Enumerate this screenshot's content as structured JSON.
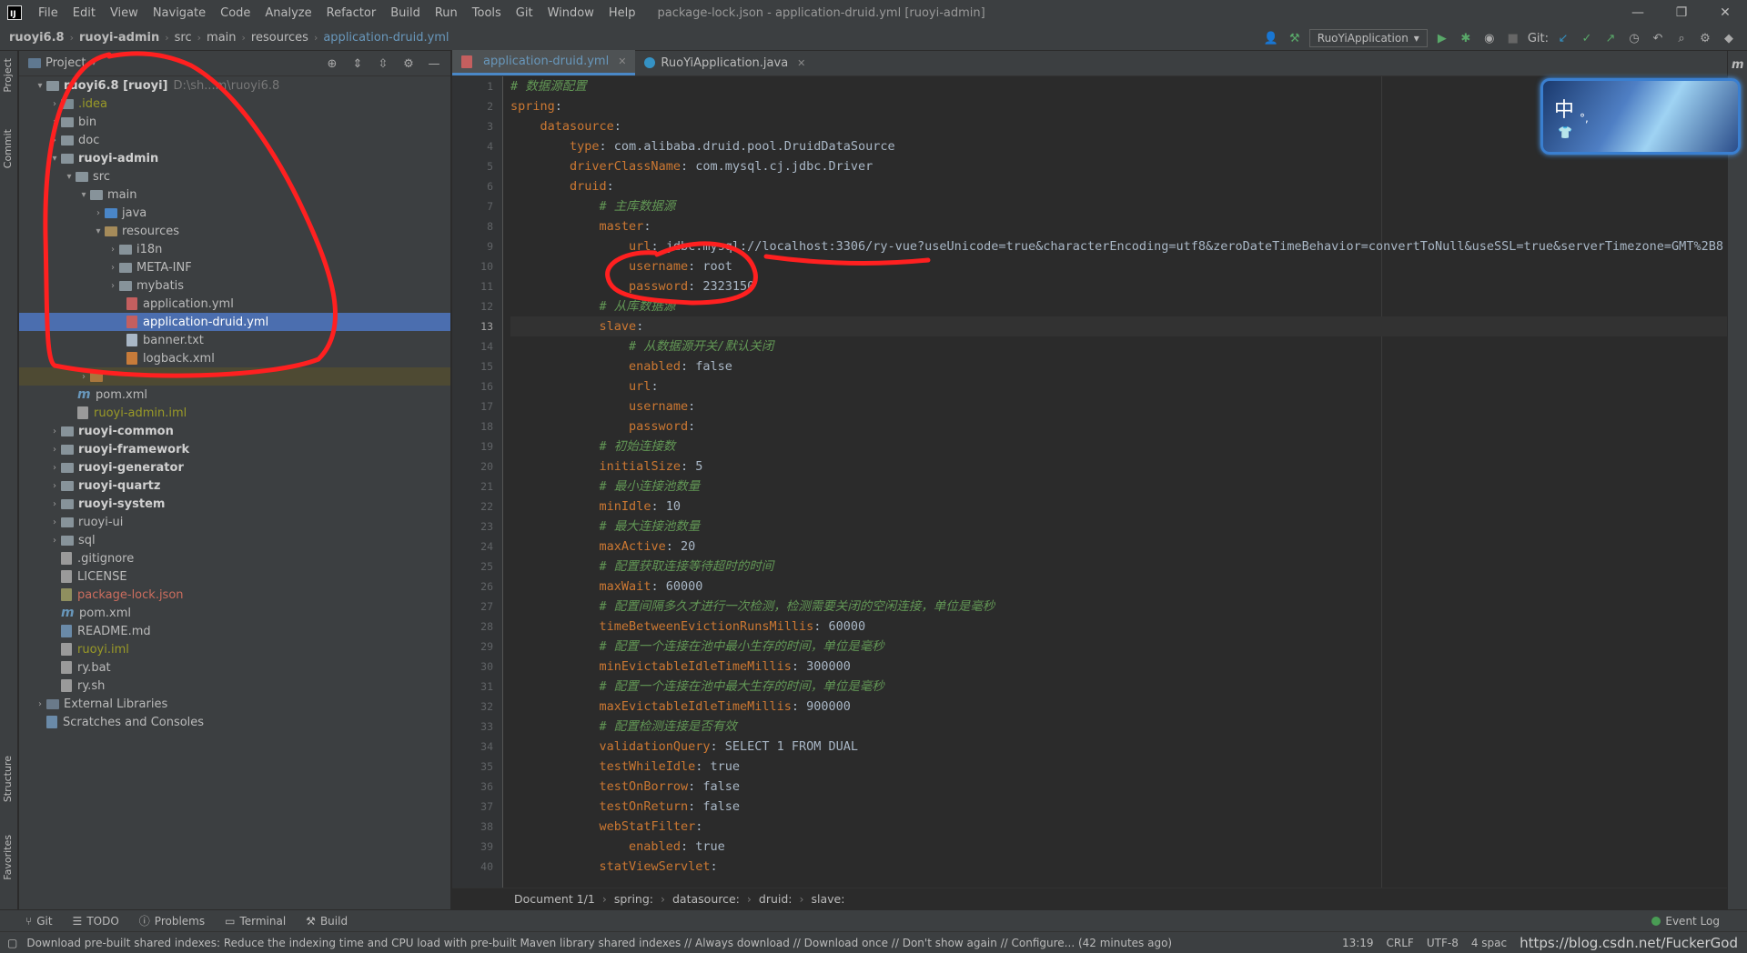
{
  "titlebar": {
    "menu": [
      "File",
      "Edit",
      "View",
      "Navigate",
      "Code",
      "Analyze",
      "Refactor",
      "Build",
      "Run",
      "Tools",
      "Git",
      "Window",
      "Help"
    ],
    "title": "package-lock.json - application-druid.yml [ruoyi-admin]",
    "min": "—",
    "max": "❐",
    "close": "✕"
  },
  "navbar": {
    "crumbs": [
      "ruoyi6.8",
      "ruoyi-admin",
      "src",
      "main",
      "resources",
      "application-druid.yml"
    ],
    "run_config": "RuoYiApplication",
    "git_label": "Git:"
  },
  "left_tabs": {
    "project": "Project",
    "commit": "Commit",
    "structure": "Structure",
    "favorites": "Favorites"
  },
  "project": {
    "header": "Project",
    "tree": [
      {
        "text": "ruoyi6.8 [ruoyi]",
        "extra": "D:\\sh...m\\ruoyi6.8"
      },
      {
        "text": ".idea"
      },
      {
        "text": "bin"
      },
      {
        "text": "doc"
      },
      {
        "text": "ruoyi-admin"
      },
      {
        "text": "src"
      },
      {
        "text": "main"
      },
      {
        "text": "java"
      },
      {
        "text": "resources"
      },
      {
        "text": "i18n"
      },
      {
        "text": "META-INF"
      },
      {
        "text": "mybatis"
      },
      {
        "text": "application.yml"
      },
      {
        "text": "application-druid.yml"
      },
      {
        "text": "banner.txt"
      },
      {
        "text": "logback.xml"
      },
      {
        "text": ""
      },
      {
        "text": "pom.xml"
      },
      {
        "text": "ruoyi-admin.iml"
      },
      {
        "text": "ruoyi-common"
      },
      {
        "text": "ruoyi-framework"
      },
      {
        "text": "ruoyi-generator"
      },
      {
        "text": "ruoyi-quartz"
      },
      {
        "text": "ruoyi-system"
      },
      {
        "text": "ruoyi-ui"
      },
      {
        "text": "sql"
      },
      {
        "text": ".gitignore"
      },
      {
        "text": "LICENSE"
      },
      {
        "text": "package-lock.json"
      },
      {
        "text": "pom.xml"
      },
      {
        "text": "README.md"
      },
      {
        "text": "ruoyi.iml"
      },
      {
        "text": "ry.bat"
      },
      {
        "text": "ry.sh"
      },
      {
        "text": "External Libraries"
      },
      {
        "text": "Scratches and Consoles"
      }
    ]
  },
  "editor": {
    "tabs": [
      "application-druid.yml",
      "RuoYiApplication.java"
    ],
    "current_line": 13,
    "lines": [
      {
        "n": "1",
        "parts": [
          [
            "c",
            "# 数据源配置"
          ]
        ]
      },
      {
        "n": "2",
        "parts": [
          [
            "k",
            "spring"
          ],
          [
            "v",
            ":"
          ]
        ]
      },
      {
        "n": "3",
        "parts": [
          [
            "v",
            "    "
          ],
          [
            "k",
            "datasource"
          ],
          [
            "v",
            ":"
          ]
        ]
      },
      {
        "n": "4",
        "parts": [
          [
            "v",
            "        "
          ],
          [
            "k",
            "type"
          ],
          [
            "v",
            ": com.alibaba.druid.pool.DruidDataSource"
          ]
        ]
      },
      {
        "n": "5",
        "parts": [
          [
            "v",
            "        "
          ],
          [
            "k",
            "driverClassName"
          ],
          [
            "v",
            ": com.mysql.cj.jdbc.Driver"
          ]
        ]
      },
      {
        "n": "6",
        "parts": [
          [
            "v",
            "        "
          ],
          [
            "k",
            "druid"
          ],
          [
            "v",
            ":"
          ]
        ]
      },
      {
        "n": "7",
        "parts": [
          [
            "v",
            "            "
          ],
          [
            "c",
            "# 主库数据源"
          ]
        ]
      },
      {
        "n": "8",
        "parts": [
          [
            "v",
            "            "
          ],
          [
            "k",
            "master"
          ],
          [
            "v",
            ":"
          ]
        ]
      },
      {
        "n": "9",
        "parts": [
          [
            "v",
            "                "
          ],
          [
            "k",
            "url"
          ],
          [
            "v",
            ": jdbc:mysql://localhost:3306/ry-vue?useUnicode=true&characterEncoding=utf8&zeroDateTimeBehavior=convertToNull&useSSL=true&serverTimezone=GMT%2B8"
          ]
        ]
      },
      {
        "n": "10",
        "parts": [
          [
            "v",
            "                "
          ],
          [
            "k",
            "username"
          ],
          [
            "v",
            ": root"
          ]
        ]
      },
      {
        "n": "11",
        "parts": [
          [
            "v",
            "                "
          ],
          [
            "k",
            "password"
          ],
          [
            "v",
            ": 2323150"
          ]
        ]
      },
      {
        "n": "12",
        "parts": [
          [
            "v",
            "            "
          ],
          [
            "c",
            "# 从库数据源"
          ]
        ]
      },
      {
        "n": "13",
        "parts": [
          [
            "v",
            "            "
          ],
          [
            "k",
            "slave"
          ],
          [
            "v",
            ":"
          ]
        ]
      },
      {
        "n": "14",
        "parts": [
          [
            "v",
            "                "
          ],
          [
            "c",
            "# 从数据源开关/默认关闭"
          ]
        ]
      },
      {
        "n": "15",
        "parts": [
          [
            "v",
            "                "
          ],
          [
            "k",
            "enabled"
          ],
          [
            "v",
            ": false"
          ]
        ]
      },
      {
        "n": "16",
        "parts": [
          [
            "v",
            "                "
          ],
          [
            "k",
            "url"
          ],
          [
            "v",
            ":"
          ]
        ]
      },
      {
        "n": "17",
        "parts": [
          [
            "v",
            "                "
          ],
          [
            "k",
            "username"
          ],
          [
            "v",
            ":"
          ]
        ]
      },
      {
        "n": "18",
        "parts": [
          [
            "v",
            "                "
          ],
          [
            "k",
            "password"
          ],
          [
            "v",
            ":"
          ]
        ]
      },
      {
        "n": "19",
        "parts": [
          [
            "v",
            "            "
          ],
          [
            "c",
            "# 初始连接数"
          ]
        ]
      },
      {
        "n": "20",
        "parts": [
          [
            "v",
            "            "
          ],
          [
            "k",
            "initialSize"
          ],
          [
            "v",
            ": 5"
          ]
        ]
      },
      {
        "n": "21",
        "parts": [
          [
            "v",
            "            "
          ],
          [
            "c",
            "# 最小连接池数量"
          ]
        ]
      },
      {
        "n": "22",
        "parts": [
          [
            "v",
            "            "
          ],
          [
            "k",
            "minIdle"
          ],
          [
            "v",
            ": 10"
          ]
        ]
      },
      {
        "n": "23",
        "parts": [
          [
            "v",
            "            "
          ],
          [
            "c",
            "# 最大连接池数量"
          ]
        ]
      },
      {
        "n": "24",
        "parts": [
          [
            "v",
            "            "
          ],
          [
            "k",
            "maxActive"
          ],
          [
            "v",
            ": 20"
          ]
        ]
      },
      {
        "n": "25",
        "parts": [
          [
            "v",
            "            "
          ],
          [
            "c",
            "# 配置获取连接等待超时的时间"
          ]
        ]
      },
      {
        "n": "26",
        "parts": [
          [
            "v",
            "            "
          ],
          [
            "k",
            "maxWait"
          ],
          [
            "v",
            ": 60000"
          ]
        ]
      },
      {
        "n": "27",
        "parts": [
          [
            "v",
            "            "
          ],
          [
            "c",
            "# 配置间隔多久才进行一次检测，检测需要关闭的空闲连接，单位是毫秒"
          ]
        ]
      },
      {
        "n": "28",
        "parts": [
          [
            "v",
            "            "
          ],
          [
            "k",
            "timeBetweenEvictionRunsMillis"
          ],
          [
            "v",
            ": 60000"
          ]
        ]
      },
      {
        "n": "29",
        "parts": [
          [
            "v",
            "            "
          ],
          [
            "c",
            "# 配置一个连接在池中最小生存的时间，单位是毫秒"
          ]
        ]
      },
      {
        "n": "30",
        "parts": [
          [
            "v",
            "            "
          ],
          [
            "k",
            "minEvictableIdleTimeMillis"
          ],
          [
            "v",
            ": 300000"
          ]
        ]
      },
      {
        "n": "31",
        "parts": [
          [
            "v",
            "            "
          ],
          [
            "c",
            "# 配置一个连接在池中最大生存的时间，单位是毫秒"
          ]
        ]
      },
      {
        "n": "32",
        "parts": [
          [
            "v",
            "            "
          ],
          [
            "k",
            "maxEvictableIdleTimeMillis"
          ],
          [
            "v",
            ": 900000"
          ]
        ]
      },
      {
        "n": "33",
        "parts": [
          [
            "v",
            "            "
          ],
          [
            "c",
            "# 配置检测连接是否有效"
          ]
        ]
      },
      {
        "n": "34",
        "parts": [
          [
            "v",
            "            "
          ],
          [
            "k",
            "validationQuery"
          ],
          [
            "v",
            ": SELECT 1 FROM DUAL"
          ]
        ]
      },
      {
        "n": "35",
        "parts": [
          [
            "v",
            "            "
          ],
          [
            "k",
            "testWhileIdle"
          ],
          [
            "v",
            ": true"
          ]
        ]
      },
      {
        "n": "36",
        "parts": [
          [
            "v",
            "            "
          ],
          [
            "k",
            "testOnBorrow"
          ],
          [
            "v",
            ": false"
          ]
        ]
      },
      {
        "n": "37",
        "parts": [
          [
            "v",
            "            "
          ],
          [
            "k",
            "testOnReturn"
          ],
          [
            "v",
            ": false"
          ]
        ]
      },
      {
        "n": "38",
        "parts": [
          [
            "v",
            "            "
          ],
          [
            "k",
            "webStatFilter"
          ],
          [
            "v",
            ":"
          ]
        ]
      },
      {
        "n": "39",
        "parts": [
          [
            "v",
            "                "
          ],
          [
            "k",
            "enabled"
          ],
          [
            "v",
            ": true"
          ]
        ]
      },
      {
        "n": "40",
        "parts": [
          [
            "v",
            "            "
          ],
          [
            "k",
            "statViewServlet"
          ],
          [
            "v",
            ":"
          ]
        ]
      }
    ],
    "breadcrumb": [
      "Document 1/1",
      "spring:",
      "datasource:",
      "druid:",
      "slave:"
    ]
  },
  "ime": {
    "label": "中",
    "dot": "°,"
  },
  "bottombar": {
    "git": "Git",
    "todo": "TODO",
    "problems": "Problems",
    "terminal": "Terminal",
    "build": "Build",
    "event_log": "Event Log"
  },
  "statusbar": {
    "message": "Download pre-built shared indexes: Reduce the indexing time and CPU load with pre-built Maven library shared indexes // Always download // Download once // Don't show again // Configure... (42 minutes ago)",
    "position": "13:19",
    "line_sep": "CRLF",
    "encoding": "UTF-8",
    "indent": "4 spac",
    "watermark": "https://blog.csdn.net/FuckerGod"
  },
  "colors": {
    "accent": "#4b6eaf",
    "annotation": "#ff2020",
    "keyword": "#cc7832",
    "comment": "#629755"
  }
}
